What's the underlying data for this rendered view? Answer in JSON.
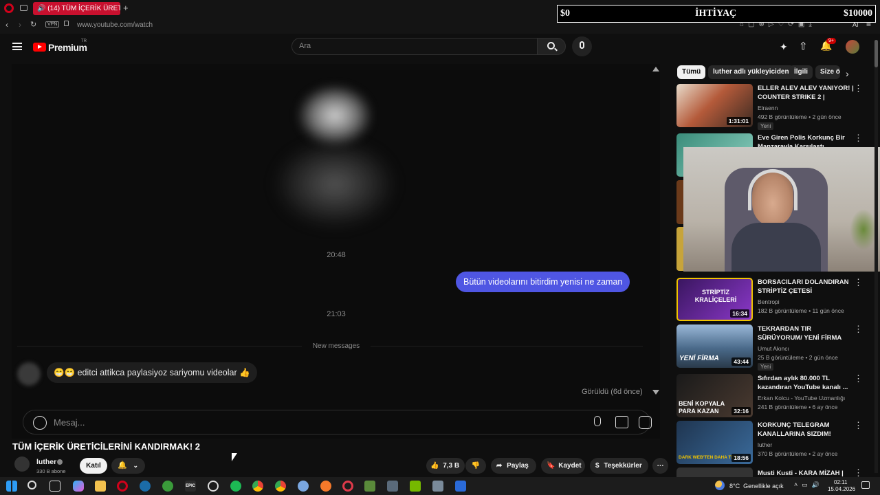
{
  "browser": {
    "tab_title": "(14) TÜM İÇERİK ÜRETİ",
    "url": "www.youtube.com/watch",
    "vpn_label": "VPN",
    "ai_label": "AI"
  },
  "overlay": {
    "left": "$0",
    "center": "İHTİYAÇ",
    "right": "$10000"
  },
  "youtube": {
    "logo_text": "Premium",
    "logo_region": "TR",
    "search_placeholder": "Ara",
    "notification_badge": "9+"
  },
  "chat": {
    "timestamp_1": "20:48",
    "outgoing_message": "Bütün videolarını bitirdim yenisi ne zaman",
    "timestamp_2": "21:03",
    "new_messages_label": "New messages",
    "incoming_message": "😁😁 editci attikca paylasiyoz sariyomu videolar 👍",
    "seen_label": "Görüldü (6d önce)",
    "input_placeholder": "Mesaj..."
  },
  "video": {
    "title": "TÜM İÇERİK ÜRETİCİLERİNİ KANDIRMAK! 2",
    "channel_name": "luther",
    "subscribers": "330 B abone",
    "join_label": "Katıl",
    "like_count": "7,3 B",
    "share_label": "Paylaş",
    "save_label": "Kaydet",
    "thanks_label": "Teşekkürler"
  },
  "sidebar": {
    "chips": [
      "Tümü",
      "luther adlı yükleyiciden",
      "İlgili",
      "Size ö"
    ],
    "recommendations": [
      {
        "title": "ELLER ALEV ALEV YANIYOR! | COUNTER STRIKE 2 |",
        "channel": "Elraenn",
        "verified": true,
        "meta": "492 B görüntüleme • 2 gün önce",
        "badge": "Yeni",
        "duration": "1:31:01",
        "thumb_color": "#b45a3a"
      },
      {
        "title": "Eve Giren Polis Korkunç Bir Manzarayla Karşılaştı",
        "channel": "",
        "verified": false,
        "meta": "",
        "badge": "",
        "duration": "",
        "thumb_color": "#3a8c7a"
      },
      {
        "title": "BORSACILARI DOLANDIRAN STRİPTİZ ÇETESİ",
        "channel": "Bentropi",
        "verified": true,
        "meta": "182 B görüntüleme • 11 gün önce",
        "badge": "",
        "duration": "16:34",
        "thumb_color": "#6a2aa0",
        "thumb_text": "STRİPTİZ KRALİÇELERİ"
      },
      {
        "title": "TEKRARDAN TIR SÜRÜYORUM/ YENİ FİRMA",
        "channel": "Umut Akıncı",
        "verified": false,
        "meta": "25 B görüntüleme • 2 gün önce",
        "badge": "Yeni",
        "duration": "43:44",
        "thumb_color": "#4a6a8a",
        "thumb_text": "YENİ FİRMA"
      },
      {
        "title": "Sıfırdan aylık 80.000 TL kazandıran YouTube kanalı ...",
        "channel": "Erkan Kolcu - YouTube Uzmanlığı",
        "verified": false,
        "meta": "241 B görüntüleme • 6 ay önce",
        "badge": "",
        "duration": "32:16",
        "thumb_color": "#2a2a2a",
        "thumb_text": "BENİ KOPYALA PARA KAZAN"
      },
      {
        "title": "KORKUNÇ TELEGRAM KANALLARINA SIZDIM!",
        "channel": "luther",
        "verified": true,
        "meta": "370 B görüntüleme • 2 ay önce",
        "badge": "",
        "duration": "18:56",
        "thumb_color": "#1f3550",
        "thumb_text": "DARK WEB'TEN DAHA TEH"
      },
      {
        "title": "Musti Kusti - KARA MİZAH |",
        "channel": "",
        "verified": false,
        "meta": "",
        "badge": "",
        "duration": "",
        "thumb_color": "#333333"
      }
    ]
  },
  "taskbar": {
    "weather": "8°C  Genellikle açık",
    "time": "02:11",
    "date": "15.04.2026",
    "epic_label": "EPIC"
  }
}
